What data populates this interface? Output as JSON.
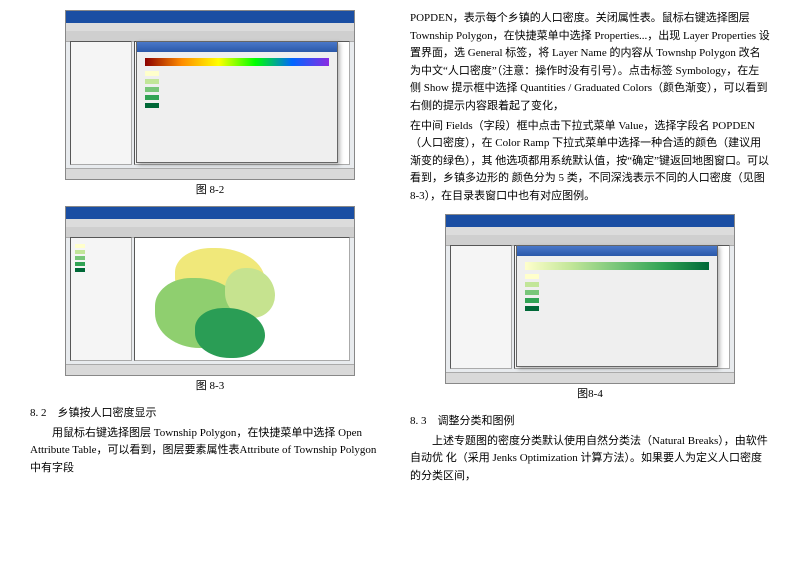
{
  "left": {
    "fig1_caption": "图 8-2",
    "fig2_caption": "图 8-3",
    "heading": "8. 2　乡镇按人口密度显示",
    "p1": "用鼠标右键选择图层 Township Polygon，在快捷菜单中选择 Open Attribute Table，可以看到，图层要素属性表Attribute of Township Polygon 中有字段"
  },
  "right": {
    "p1": "POPDEN，表示每个乡镇的人口密度。关闭属性表。鼠标右键选择图层 Township Polygon，在快捷菜单中选择 Properties...，出现 Layer Properties 设置界面，选 General 标签，将 Layer Name 的内容从 Townshp Polygon 改名为中文“人口密度”（注意：操作时没有引号）。点击标签 Symbology，在左侧 Show 提示框中选择 Quantities / Graduated Colors（颜色渐变），可以看到右侧的提示内容跟着起了变化，",
    "p2": "在中间 Fields（字段）框中点击下拉式菜单 Value，选择字段名 POPDEN（人口密度），在 Color Ramp 下拉式菜单中选择一种合适的颜色（建议用渐变的绿色），其 他选项都用系统默认值，按“确定”键返回地图窗口。可以看到，乡镇多边形的 颜色分为 5 类，不同深浅表示不同的人口密度（见图 8-3），在目录表窗口中也有对应图例。",
    "fig_caption": "图8-4",
    "heading": "8. 3　调整分类和图例",
    "p3": "上述专题图的密度分类默认使用自然分类法（Natural Breaks），由软件自动优 化（采用 Jenks Optimization 计算方法）。如果要人为定义人口密度的分类区间，"
  }
}
